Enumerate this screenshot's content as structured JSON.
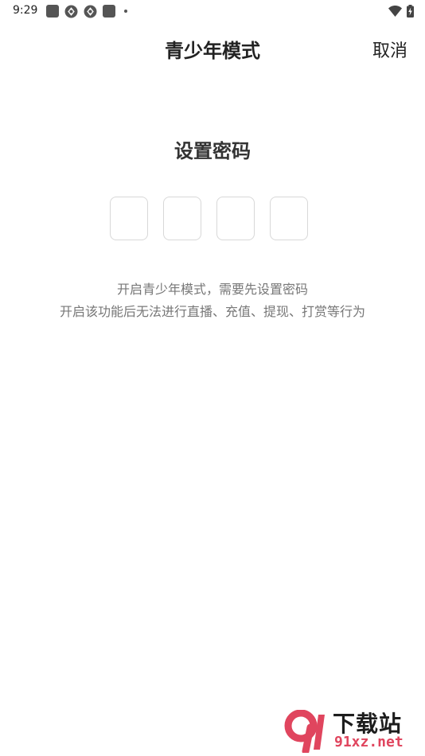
{
  "status_bar": {
    "time": "9:29",
    "icons_left": [
      "square-icon",
      "aperture-icon",
      "aperture-icon",
      "square-icon",
      "dot-icon"
    ],
    "icons_right": [
      "wifi-icon",
      "battery-charging-icon"
    ]
  },
  "header": {
    "title": "青少年模式",
    "cancel_label": "取消"
  },
  "password": {
    "title": "设置密码",
    "digit_count": 4,
    "hint_line_1": "开启青少年模式，需要先设置密码",
    "hint_line_2": "开启该功能后无法进行直播、充值、提现、打赏等行为"
  },
  "watermark": {
    "logo_text": "9",
    "title": "下载站",
    "domain": "91xz.net"
  },
  "colors": {
    "watermark_accent": "#e0455e",
    "pin_border": "#d8d8d8",
    "hint_text": "#777777"
  }
}
